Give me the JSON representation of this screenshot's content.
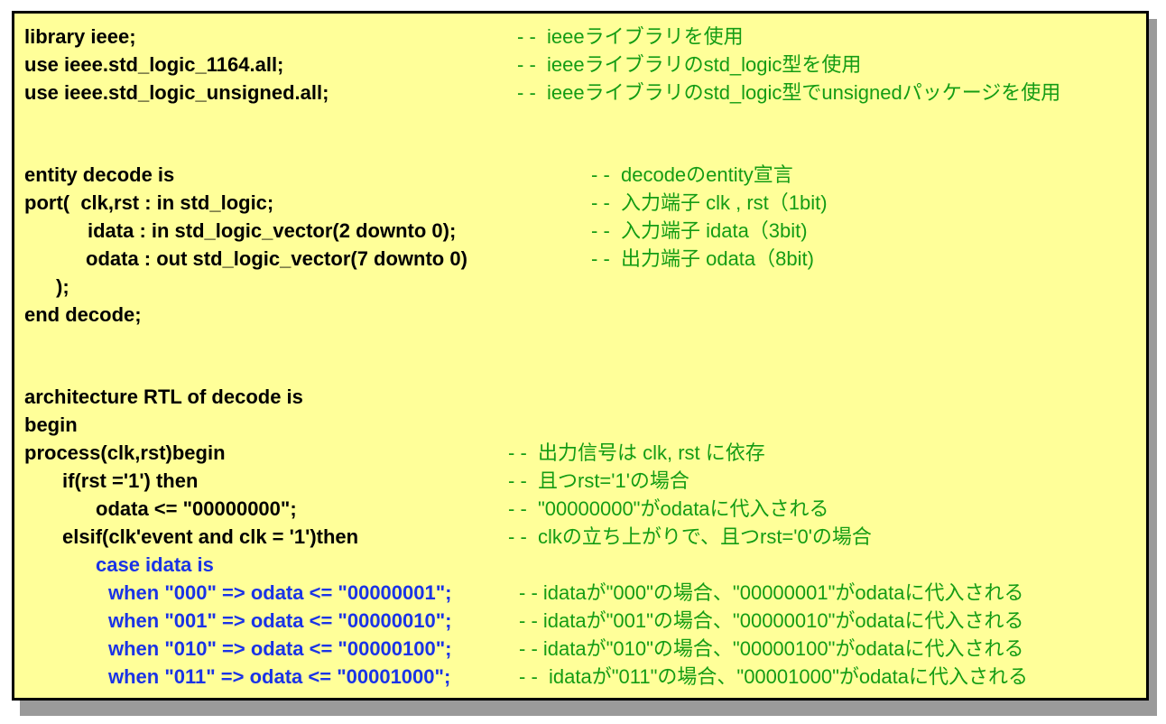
{
  "code_lines": [
    {
      "code": "library ieee;",
      "comment": "- -  ieeeライブラリを使用"
    },
    {
      "code": "use ieee.std_logic_1164.all;",
      "comment": "- -  ieeeライブラリのstd_logic型を使用"
    },
    {
      "code": "use ieee.std_logic_unsigned.all;",
      "comment": "- -  ieeeライブラリのstd_logic型でunsignedパッケージを使用"
    },
    {
      "code": "entity decode is",
      "comment": "- -  decodeのentity宣言"
    },
    {
      "code": "port(  clk,rst : in std_logic;",
      "comment": "- -  入力端子 clk , rst（1bit)"
    },
    {
      "code": "idata : in std_logic_vector(2 downto 0);",
      "comment": "- -  入力端子 idata（3bit)"
    },
    {
      "code": "odata : out std_logic_vector(7 downto 0)",
      "comment": "- -  出力端子 odata（8bit)"
    },
    {
      "code": ");",
      "comment": ""
    },
    {
      "code": "end decode;",
      "comment": ""
    },
    {
      "code": "architecture RTL of decode is",
      "comment": ""
    },
    {
      "code": "begin",
      "comment": ""
    },
    {
      "code": "process(clk,rst)begin",
      "comment": "- -  出力信号は clk, rst に依存"
    },
    {
      "code": "if(rst ='1') then",
      "comment": "- -  且つrst='1'の場合"
    },
    {
      "code": "odata <= \"00000000\";",
      "comment": "- -  \"00000000\"がodataに代入される"
    },
    {
      "code": "elsif(clk'event and clk = '1')then",
      "comment": "- -  clkの立ち上がりで、且つrst='0'の場合"
    },
    {
      "code": "case idata is",
      "comment": ""
    },
    {
      "code": "when \"000\" => odata <= \"00000001\";",
      "comment": "- - idataが\"000\"の場合、\"00000001\"がodataに代入される"
    },
    {
      "code": "when \"001\" => odata <= \"00000010\";",
      "comment": "- - idataが\"001\"の場合、\"00000010\"がodataに代入される"
    },
    {
      "code": "when \"010\" => odata <= \"00000100\";",
      "comment": "- - idataが\"010\"の場合、\"00000100\"がodataに代入される"
    },
    {
      "code": "when \"011\" => odata <= \"00001000\";",
      "comment": "- -  idataが\"011\"の場合、\"00001000\"がodataに代入される"
    }
  ],
  "colors": {
    "background": "#ffff99",
    "code_text": "#000000",
    "case_block_text": "#1a33e6",
    "comment_text": "#149c14",
    "border": "#000000",
    "shadow": "#9a9a9a"
  }
}
